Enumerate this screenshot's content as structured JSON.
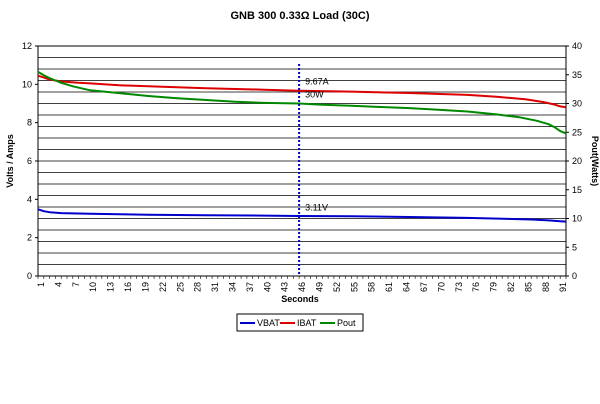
{
  "chart_data": {
    "type": "line",
    "title": "GNB 300  0.33Ω Load (30C)",
    "xlabel": "Seconds",
    "ylabel_left": "Volts / Amps",
    "ylabel_right": "Pout(Watts)",
    "x_range": [
      1,
      92
    ],
    "x_ticks": [
      "1",
      "4",
      "7",
      "10",
      "13",
      "16",
      "19",
      "22",
      "25",
      "28",
      "31",
      "34",
      "37",
      "40",
      "43",
      "46",
      "49",
      "52",
      "55",
      "58",
      "61",
      "64",
      "67",
      "70",
      "73",
      "76",
      "79",
      "82",
      "85",
      "88",
      "91"
    ],
    "ylim_left": [
      0,
      12
    ],
    "y_ticks_left": [
      "0",
      "2",
      "4",
      "6",
      "8",
      "10",
      "12"
    ],
    "ylim_right": [
      0,
      40
    ],
    "y_ticks_right": [
      "0",
      "5",
      "10",
      "15",
      "20",
      "25",
      "30",
      "35",
      "40"
    ],
    "grid": true,
    "legend_position": "bottom",
    "marker_x": 46,
    "annotations": [
      {
        "text": "9.67A",
        "x": 46,
        "y": 9.67,
        "axis": "left"
      },
      {
        "text": "30W",
        "x": 46,
        "y": 30,
        "axis": "right"
      },
      {
        "text": "3.11V",
        "x": 46,
        "y": 3.11,
        "axis": "left"
      }
    ],
    "series": [
      {
        "name": "VBAT",
        "axis": "left",
        "color": "#0000cc",
        "x": [
          1,
          2,
          3,
          5,
          8,
          10,
          15,
          20,
          30,
          40,
          46,
          55,
          65,
          75,
          82,
          86,
          89,
          91,
          92
        ],
        "values": [
          3.48,
          3.38,
          3.33,
          3.28,
          3.26,
          3.25,
          3.22,
          3.2,
          3.17,
          3.15,
          3.13,
          3.12,
          3.08,
          3.03,
          2.98,
          2.95,
          2.9,
          2.86,
          2.84
        ]
      },
      {
        "name": "IBAT",
        "axis": "left",
        "color": "#dd0000",
        "x": [
          1,
          2,
          3,
          5,
          8,
          10,
          15,
          20,
          30,
          40,
          46,
          55,
          65,
          75,
          80,
          85,
          88,
          90,
          91,
          92
        ],
        "values": [
          10.45,
          10.35,
          10.25,
          10.15,
          10.08,
          10.05,
          9.95,
          9.9,
          9.8,
          9.72,
          9.67,
          9.62,
          9.55,
          9.45,
          9.35,
          9.22,
          9.08,
          8.95,
          8.85,
          8.8
        ]
      },
      {
        "name": "Pout",
        "axis": "right",
        "color": "#008800",
        "x": [
          1,
          2,
          3,
          4,
          5,
          7,
          10,
          15,
          20,
          25,
          30,
          35,
          40,
          46,
          50,
          55,
          60,
          65,
          70,
          75,
          80,
          84,
          87,
          89,
          90,
          91,
          92
        ],
        "values": [
          35.5,
          34.9,
          34.4,
          34.0,
          33.6,
          33.0,
          32.3,
          31.8,
          31.3,
          30.9,
          30.6,
          30.3,
          30.1,
          30.0,
          29.8,
          29.6,
          29.4,
          29.2,
          28.9,
          28.6,
          28.1,
          27.6,
          27.0,
          26.4,
          25.9,
          25.2,
          24.8
        ]
      }
    ]
  }
}
